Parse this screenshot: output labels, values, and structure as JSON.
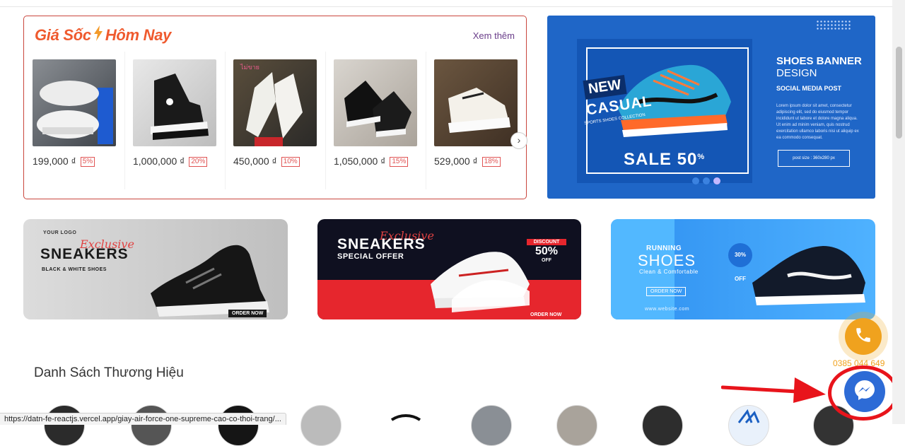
{
  "flash_sale": {
    "title_left": "Giá Sốc",
    "title_right": "Hôm Nay",
    "see_more": "Xem thêm",
    "products": [
      {
        "price": "199,000 ₫",
        "discount": "5%"
      },
      {
        "price": "1,000,000 ₫",
        "discount": "20%"
      },
      {
        "price": "450,000 ₫",
        "discount": "10%"
      },
      {
        "price": "1,050,000 ₫",
        "discount": "15%"
      },
      {
        "price": "529,000 ₫",
        "discount": "18%"
      }
    ],
    "next_icon": "chevron-right-icon"
  },
  "main_banner": {
    "new": "NEW",
    "casual": "CASUAL",
    "sub": "SPORTS SHOES COLLECTION",
    "sale": "SALE 50",
    "heading1": "SHOES BANNER",
    "heading2": "DESIGN",
    "heading3": "SOCIAL MEDIA POST",
    "lorem": "Lorem ipsum dolor sit amet, consectetur adipiscing elit, sed do eiusmod tempor incididunt ut labore et dolore magna aliqua. Ut enim ad minim veniam, quis nostrud exercitation ullamco laboris nisi ut aliquip ex ea commodo consequat.",
    "post_size": "post size : 360x280 px"
  },
  "banners": [
    {
      "exclusive": "Exclusive",
      "title": "SNEAKERS",
      "subtitle": "BLACK & WHITE SHOES",
      "cta": "ORDER NOW",
      "logo": "YOUR LOGO"
    },
    {
      "exclusive": "Exclusive",
      "title": "SNEAKERS",
      "subtitle": "SPECIAL OFFER",
      "discount_label": "DISCOUNT",
      "discount": "50%",
      "off": "OFF",
      "cta": "ORDER NOW"
    },
    {
      "kicker": "RUNNING",
      "title": "SHOES",
      "subtitle": "Clean & Comfortable",
      "badge": "30% OFF",
      "cta": "ORDER NOW",
      "site": "www.website.com"
    }
  ],
  "brands": {
    "title": "Danh Sách Thương Hiệu"
  },
  "contact": {
    "phone_number": "0385 044 649",
    "phone_icon": "phone-icon",
    "messenger_icon": "messenger-icon"
  },
  "status_bar": {
    "url": "https://datn-fe-reactjs.vercel.app/giay-air-force-one-supreme-cao-co-thoi-trang/..."
  },
  "colors": {
    "accent_orange": "#ef5a2e",
    "flash_border": "#c9463d",
    "highlight_red": "#e8141b",
    "messenger_blue": "#2d6bd6",
    "phone_orange": "#f0a21e"
  }
}
